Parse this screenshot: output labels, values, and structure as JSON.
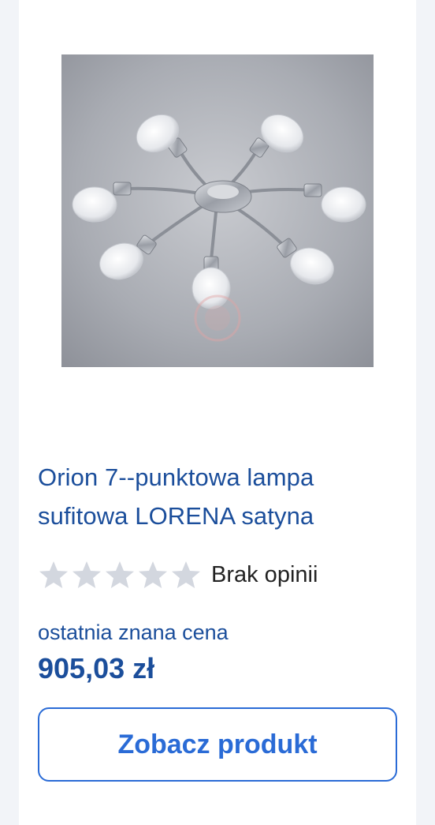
{
  "product": {
    "image_alt": "Orion 7--punktowa lampa sufitowa LORENA satyna",
    "title": "Orion 7--punktowa lampa sufitowa LORENA satyna",
    "rating": {
      "stars_filled": 0,
      "stars_total": 5,
      "text": "Brak opinii"
    },
    "price_label": "ostatnia znana cena",
    "price": "905,03 zł",
    "cta_label": "Zobacz produkt"
  },
  "colors": {
    "title": "#1b4e9b",
    "cta": "#2a6bd6",
    "star_empty": "#d3d7df"
  },
  "icons": {
    "star": "star-icon"
  }
}
